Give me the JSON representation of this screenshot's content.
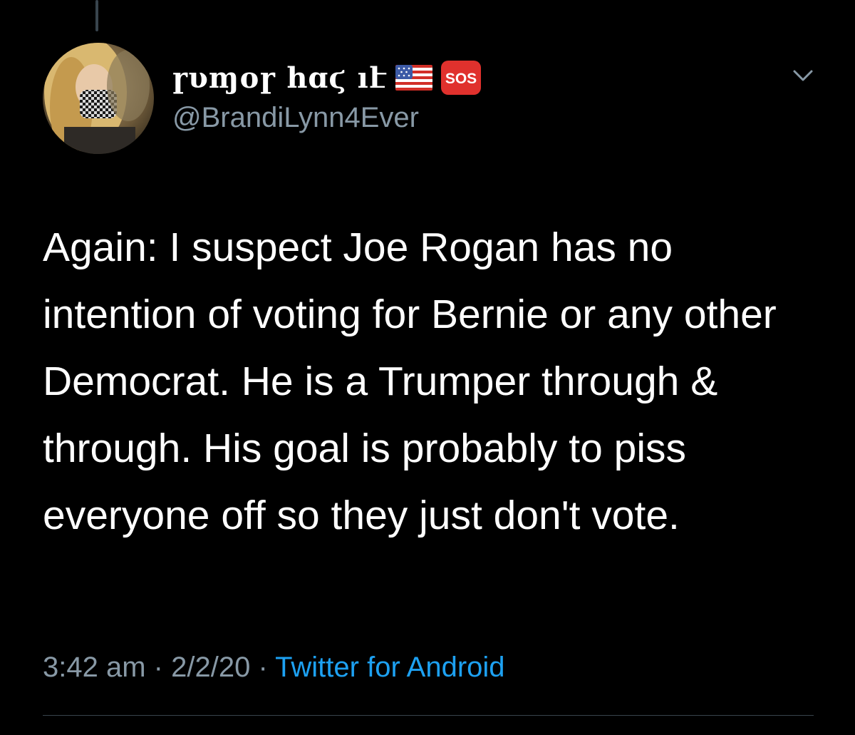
{
  "colors": {
    "background": "#000000",
    "text_primary": "#ffffff",
    "text_secondary": "#8899a6",
    "link": "#1da1f2",
    "divider": "#38444d"
  },
  "author": {
    "display_name": "ɼυɱօɼ հɑϛ ıէ",
    "handle": "@BrandiLynn4Ever",
    "emojis": [
      "flag-us-icon",
      "sos-icon"
    ],
    "sos_label": "SOS"
  },
  "tweet": {
    "text": "Again: I suspect Joe Rogan has no intention of voting for Bernie or any other Democrat. He is a Trumper through & through. His goal is probably to piss everyone off so they just don't vote.",
    "time": "3:42 am",
    "date": "2/2/20",
    "separator": "·",
    "source": "Twitter for Android"
  }
}
